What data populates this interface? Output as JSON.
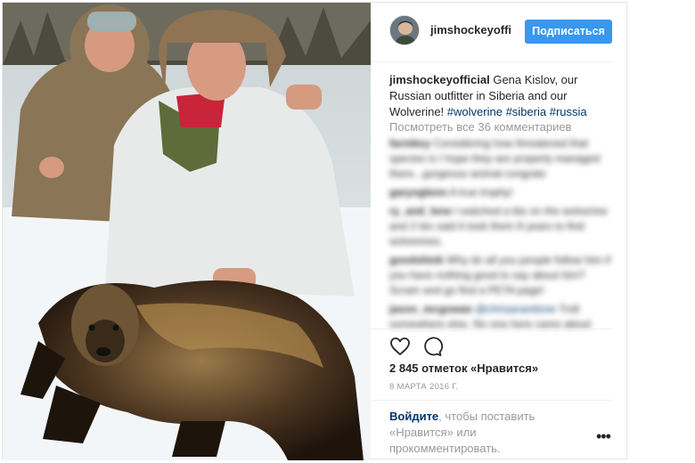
{
  "post": {
    "username": "jimshockeyofficial",
    "username_header_display": "jimshockeyoffic",
    "follow_label": "Подписаться",
    "caption_username": "jimshockeyofficial",
    "caption_text": " Gena Kislov, our Russian outfitter in Siberia and our Wolverine! ",
    "hashtags": [
      "#wolverine",
      "#siberia",
      "#russia"
    ],
    "view_all_comments": "Посмотреть все 36 комментариев",
    "comments": [
      {
        "user": "farmkey",
        "text": "Considering how threatened that species is I hope they are properly managed there...gorgeous animal congrats"
      },
      {
        "user": "garyoglenn",
        "text": "A true trophy!"
      },
      {
        "user": "ry_and_lene",
        "text": "I watched a bio on the wolverine and 2 bio said it took them 8 years to find wolverines."
      },
      {
        "user": "goodshink",
        "text": "Why do all you people follow him if you have nothing good to say about him?Scram and go find a PETA page!"
      },
      {
        "user": "jason_mcgowan",
        "mention": "@chrisananitone",
        "text": "Troll somewhere else. No one here cares about"
      }
    ],
    "likes": "2 845 отметок «Нравится»",
    "date": "8 МАРТА 2016 Г.",
    "login_link": "Войдите",
    "login_text": ", чтобы поставить «Нравится» или прокомментировать.",
    "more_label": "•••",
    "icons": [
      "heart-icon",
      "comment-icon"
    ]
  },
  "colors": {
    "accent": "#3897f0",
    "link": "#003569",
    "muted": "#999999"
  }
}
